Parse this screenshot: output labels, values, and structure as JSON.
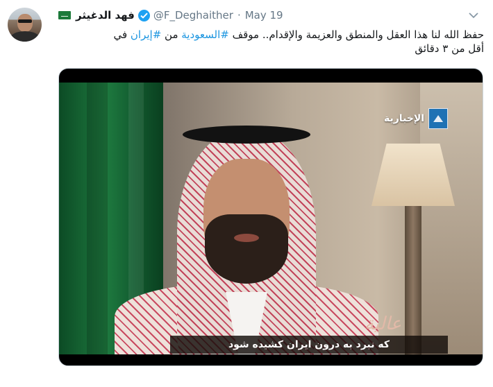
{
  "tweet": {
    "display_name": "فهد الدغيثر",
    "handle": "@F_Deghaither",
    "separator": "·",
    "date": "May 19",
    "text_line1_before": "حفظ الله لنا هذا العقل والمنطق والعزيمة والإقدام.. موقف ",
    "hashtag1": "#السعودية",
    "text_line1_mid": " من ",
    "hashtag2": "#إيران",
    "text_line1_after": " في",
    "text_line2": "أقل من ٣ دقائق"
  },
  "media": {
    "channel_name": "الإخبارية",
    "show_logo": "عالية",
    "subtitle": "که نبرد به درون ایران کشیده شود"
  },
  "icons": {
    "verified": "verified-badge-icon",
    "caret": "chevron-down-icon",
    "flag_emoji": "saudi-flag-emoji-icon"
  },
  "colors": {
    "link": "#1b95e0",
    "verified": "#1da1f2",
    "muted": "#657786",
    "text": "#14171a",
    "border": "#ccd6dd"
  }
}
